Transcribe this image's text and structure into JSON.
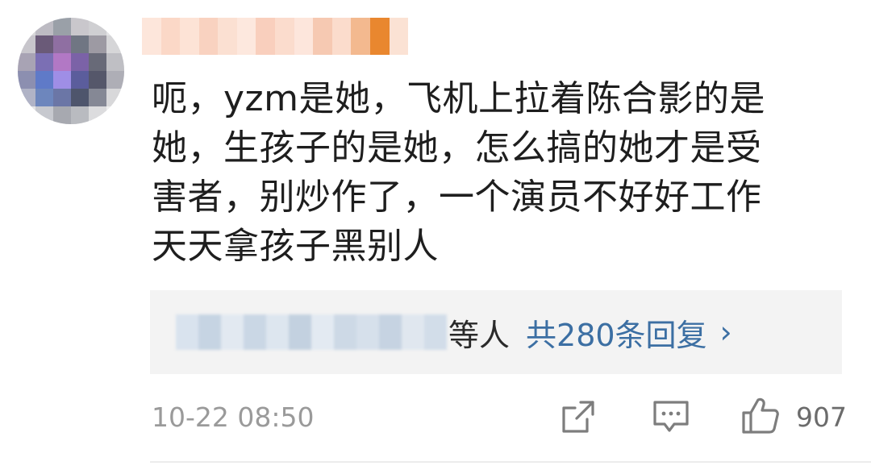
{
  "comment": {
    "line1": "呃，yzm是她，飞机上拉着陈合影的是",
    "line2": "她，生孩子的是她，怎么搞的她才是受",
    "line3": "害者，别炒作了，一个演员不好好工作",
    "line4": "天天拿孩子黑别人"
  },
  "replies": {
    "suffix": "等人",
    "link": "共280条回复",
    "chevron": "›"
  },
  "meta": {
    "timestamp": "10-22 08:50",
    "like_count": "907"
  },
  "icons": {
    "share": "share-icon",
    "comment": "comment-icon",
    "like": "thumbs-up-icon"
  },
  "colors": {
    "link": "#3c6fa3",
    "text": "#1e1e1e",
    "muted": "#9a9a9a",
    "reply_bg": "#f3f3f3"
  }
}
